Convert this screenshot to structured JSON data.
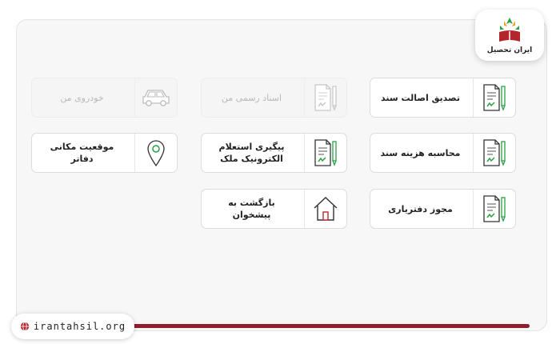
{
  "brand": {
    "logo_text": "ایران تحصیل",
    "logo_icon": "book-leaves-logo",
    "url": "irantahsil.org",
    "accent": "#8e1f2c",
    "icon_green": "#2aa044"
  },
  "services": {
    "document_authenticity": {
      "label": "تصدیق اصالت سند",
      "icon": "document-pen-icon"
    },
    "official_documents": {
      "label": "اسناد رسمی من",
      "icon": "document-pen-icon",
      "state": "disabled"
    },
    "my_vehicles": {
      "label": "خودروی من",
      "icon": "car-icon",
      "state": "disabled"
    },
    "document_cost": {
      "label": "محاسبه هزینه سند",
      "icon": "document-pen-icon"
    },
    "property_inquiry": {
      "label": "پیگیری استعلام الکترونیک ملک",
      "icon": "document-pen-icon"
    },
    "office_location": {
      "label": "موقعیت مکانی دفاتر",
      "icon": "map-pin-icon"
    },
    "notary_license": {
      "label": "مجوز دفترياری",
      "icon": "document-pen-icon"
    },
    "back_to_counter": {
      "label": "بازگشت به پیشخوان",
      "icon": "home-icon"
    }
  }
}
